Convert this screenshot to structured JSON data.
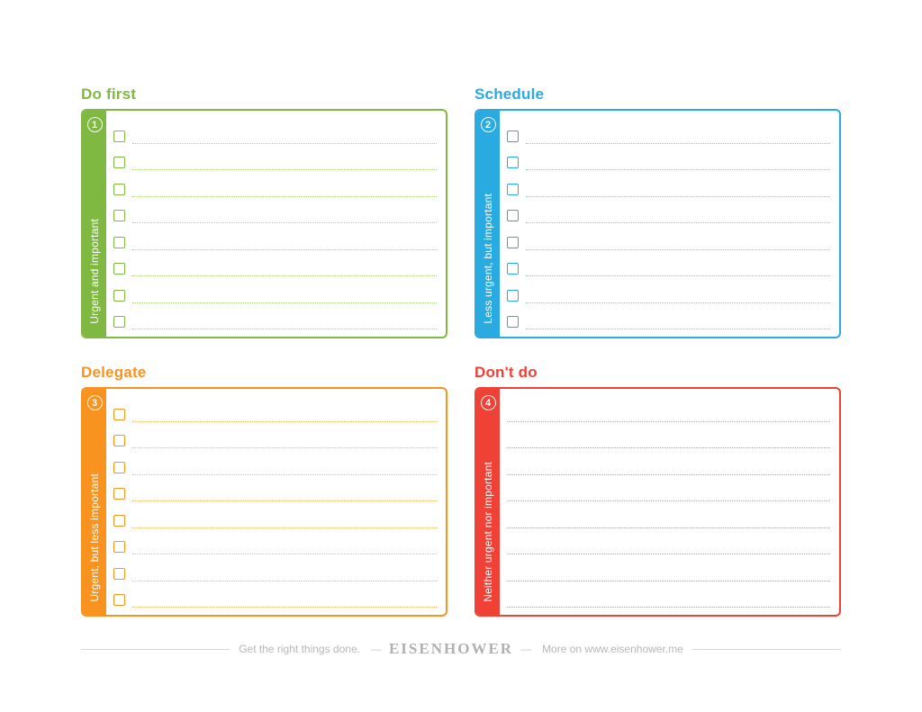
{
  "quadrants": [
    {
      "key": "q1",
      "num": "1",
      "title": "Do first",
      "side": "Urgent and important",
      "checkboxes": true
    },
    {
      "key": "q2",
      "num": "2",
      "title": "Schedule",
      "side": "Less urgent, but important",
      "checkboxes": true
    },
    {
      "key": "q3",
      "num": "3",
      "title": "Delegate",
      "side": "Urgent, but less important",
      "checkboxes": true
    },
    {
      "key": "q4",
      "num": "4",
      "title": "Don't do",
      "side": "Neither urgent nor important",
      "checkboxes": false
    }
  ],
  "rows_per_quadrant": 8,
  "footer": {
    "left": "Get the right things done.",
    "brand": "EISENHOWER",
    "right": "More on www.eisenhower.me"
  }
}
